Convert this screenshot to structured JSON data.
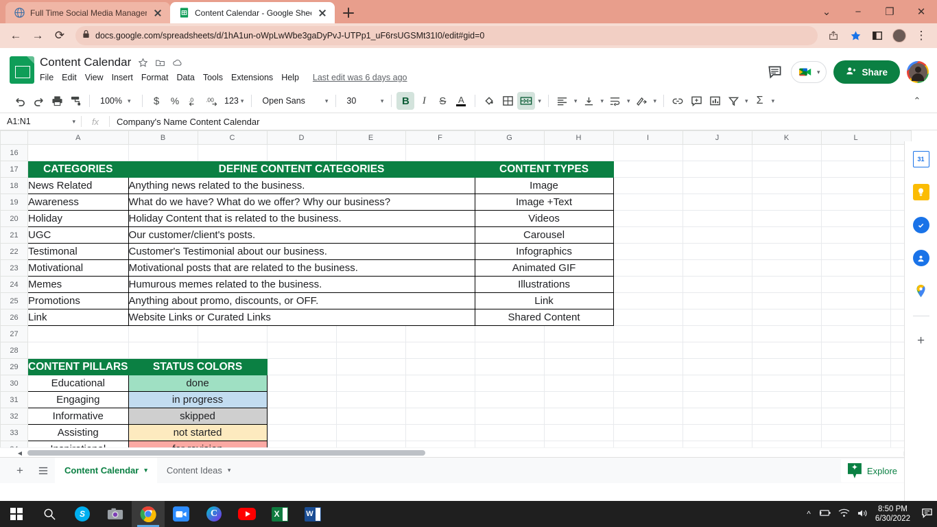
{
  "browser": {
    "tabs": [
      {
        "title": "Full Time Social Media Manager",
        "favicon": "globe-icon",
        "active": false
      },
      {
        "title": "Content Calendar - Google Shee",
        "favicon": "sheets-icon",
        "active": true
      }
    ],
    "new_tab_label": "+",
    "url": "docs.google.com/spreadsheets/d/1hA1un-oWpLwWbe3gaDyPvJ-UTPp1_uF6rsUGSMt31I0/edit#gid=0",
    "window_controls": {
      "minimize": "−",
      "maximize": "❐",
      "close": "✕",
      "tab_search": "⌄"
    },
    "nav": {
      "back": "←",
      "forward": "→",
      "reload": "⟳",
      "lock": "lock-icon",
      "share": "share-icon",
      "bookmark": "star-icon",
      "sidepanel": "panel-icon",
      "profile": "profile-avatar",
      "menu": "⋮"
    }
  },
  "sheets": {
    "doc_title": "Content Calendar",
    "title_icons": [
      "star-icon",
      "move-to-folder-icon",
      "cloud-saved-icon"
    ],
    "menus": [
      "File",
      "Edit",
      "View",
      "Insert",
      "Format",
      "Data",
      "Tools",
      "Extensions",
      "Help"
    ],
    "last_edit": "Last edit was 6 days ago",
    "header_actions": {
      "comment_icon": "comment-icon",
      "meet_icon": "google-meet-icon",
      "share_label": "Share",
      "avatar": "user-avatar"
    },
    "toolbar": {
      "undo": "↶",
      "redo": "↷",
      "print": "print-icon",
      "paint_format": "paint-format-icon",
      "zoom": "100%",
      "currency": "$",
      "percent": "%",
      "dec_decrease": ".0",
      "dec_increase": ".00",
      "formats": "123",
      "font_name": "Open Sans",
      "font_size": "30",
      "bold": "B",
      "italic": "I",
      "strikethrough": "S",
      "text_color": "A",
      "fill_color": "fill-color-icon",
      "borders": "borders-icon",
      "merge": "merge-cells-icon",
      "halign": "horizontal-align-icon",
      "valign": "vertical-align-icon",
      "wrap": "text-wrap-icon",
      "rotate": "text-rotation-icon",
      "link": "link-icon",
      "comment": "insert-comment-icon",
      "chart": "insert-chart-icon",
      "filter": "filter-icon",
      "functions": "Σ",
      "collapse": "⌃"
    },
    "formula_bar": {
      "name_box": "A1:N1",
      "fx": "fx",
      "value": "Company's Name Content Calendar"
    },
    "grid": {
      "columns": [
        "A",
        "B",
        "C",
        "D",
        "E",
        "F",
        "G",
        "H",
        "I",
        "J",
        "K",
        "L"
      ],
      "rows": [
        "16",
        "17",
        "18",
        "19",
        "20",
        "21",
        "22",
        "23",
        "24",
        "25",
        "26",
        "27",
        "28",
        "29",
        "30",
        "31",
        "32",
        "33",
        "34"
      ]
    },
    "table_categories": {
      "headers": {
        "col_a": "CATEGORIES",
        "col_bcdef": "DEFINE CONTENT CATEGORIES",
        "col_gh": "CONTENT TYPES"
      },
      "rows": [
        {
          "row": "18",
          "category": "News Related",
          "definition": "Anything news related to the business.",
          "content_type": "Image"
        },
        {
          "row": "19",
          "category": "Awareness",
          "definition": "What do we have? What do we offer? Why our business?",
          "content_type": "Image +Text"
        },
        {
          "row": "20",
          "category": "Holiday",
          "definition": "Holiday Content that is related to the business.",
          "content_type": "Videos"
        },
        {
          "row": "21",
          "category": "UGC",
          "definition": "Our customer/client's posts.",
          "content_type": "Carousel"
        },
        {
          "row": "22",
          "category": "Testimonal",
          "definition": "Customer's Testimonial about our business.",
          "content_type": "Infographics"
        },
        {
          "row": "23",
          "category": "Motivational",
          "definition": "Motivational posts that are related to the business.",
          "content_type": "Animated GIF"
        },
        {
          "row": "24",
          "category": "Memes",
          "definition": "Humurous memes related to the business.",
          "content_type": "Illustrations"
        },
        {
          "row": "25",
          "category": "Promotions",
          "definition": "Anything about promo, discounts, or OFF.",
          "content_type": "Link"
        },
        {
          "row": "26",
          "category": "Link",
          "definition": "Website Links or Curated Links",
          "content_type": "Shared Content"
        }
      ]
    },
    "table_pillars": {
      "headers": {
        "pillars": "CONTENT PILLARS",
        "status": "STATUS COLORS"
      },
      "rows": [
        {
          "row": "30",
          "pillar": "Educational",
          "status": "done",
          "color": "#9fe0c3"
        },
        {
          "row": "31",
          "pillar": "Engaging",
          "status": "in progress",
          "color": "#c2dcf0"
        },
        {
          "row": "32",
          "pillar": "Informative",
          "status": "skipped",
          "color": "#cfcfcf"
        },
        {
          "row": "33",
          "pillar": "Assisting",
          "status": "not started",
          "color": "#fdeabf"
        },
        {
          "row": "34",
          "pillar": "Inspirational",
          "status": "for revision",
          "color": "#fba9a3"
        }
      ]
    },
    "sheet_tabs": {
      "add": "+",
      "all_sheets": "all-sheets-icon",
      "tabs": [
        {
          "label": "Content Calendar",
          "active": true
        },
        {
          "label": "Content Ideas",
          "active": false
        }
      ]
    },
    "explore": {
      "label": "Explore",
      "icon": "explore-icon"
    },
    "side_panel": [
      "google-calendar-icon",
      "google-keep-icon",
      "google-tasks-icon",
      "google-contacts-icon",
      "google-maps-icon",
      "add-ons-plus-icon"
    ],
    "colors": {
      "accent": "#0b8043",
      "header_green": "#0b8043",
      "share_green": "#0b8043"
    }
  },
  "taskbar": {
    "icons": [
      "windows-start-icon",
      "search-icon",
      "skype-icon",
      "camera-icon",
      "chrome-icon",
      "video-app-icon",
      "canva-icon",
      "youtube-icon",
      "excel-icon",
      "word-icon"
    ],
    "tray": {
      "chevron": "^",
      "battery": "battery-icon",
      "wifi": "wifi-icon",
      "volume": "volume-icon",
      "notifications": "notification-icon"
    },
    "time": "8:50 PM",
    "date": "6/30/2022"
  }
}
